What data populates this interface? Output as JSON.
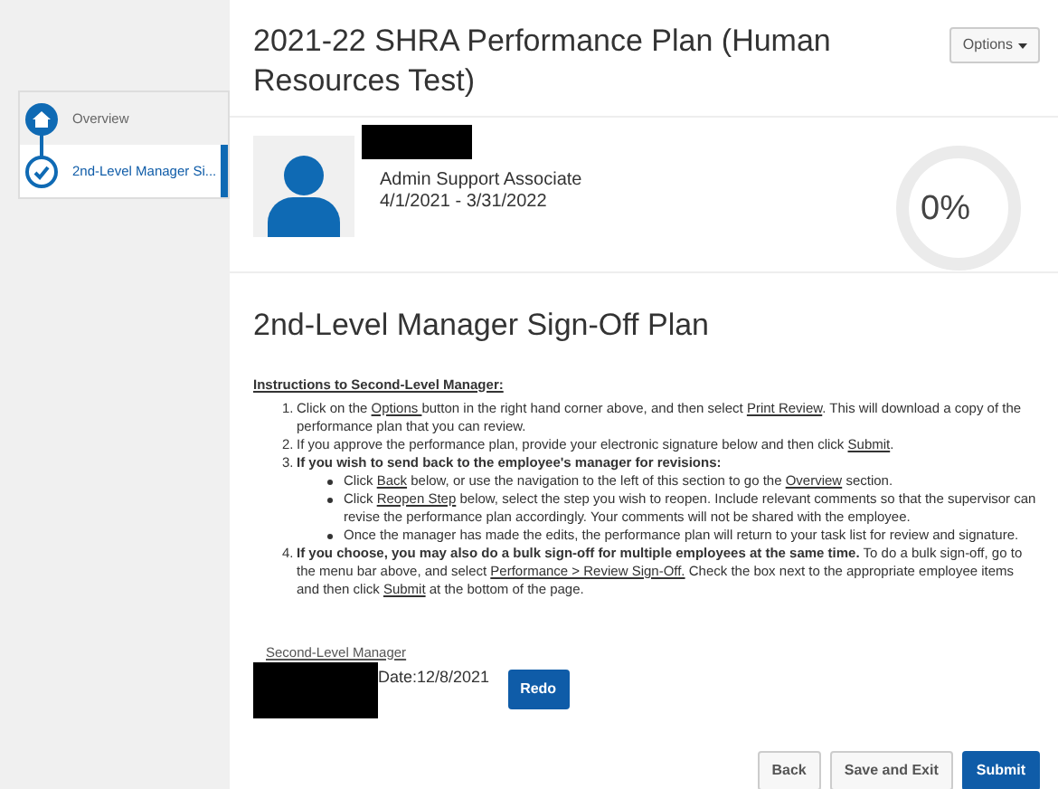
{
  "sidebar": {
    "items": [
      {
        "label": "Overview",
        "kind": "home",
        "selected": false
      },
      {
        "label": "2nd-Level Manager Si...",
        "kind": "check",
        "selected": true
      }
    ]
  },
  "header": {
    "title": "2021-22 SHRA Performance Plan (Human Resources Test)",
    "options_button": "Options"
  },
  "profile": {
    "job_title": "Admin Support Associate",
    "period": "4/1/2021 - 3/31/2022",
    "progress": {
      "level": 0,
      "reading": "0%"
    }
  },
  "section": {
    "title": "2nd-Level Manager Sign-Off Plan",
    "instructions_heading": "Instructions to Second-Level Manager:",
    "steps": [
      {
        "marker": "1.",
        "segments": [
          {
            "kind": "plain",
            "text": "Click on the "
          },
          {
            "kind": "link",
            "text": "Options "
          },
          {
            "kind": "plain",
            "text": "button in the right hand corner above, and then select "
          },
          {
            "kind": "link",
            "text": "Print Review"
          },
          {
            "kind": "plain",
            "text": ". This will download a copy of the performance plan that you can review."
          }
        ]
      },
      {
        "marker": "2.",
        "segments": [
          {
            "kind": "plain",
            "text": "If you approve the performance plan, provide your electronic signature below and then click "
          },
          {
            "kind": "link",
            "text": "Submit"
          },
          {
            "kind": "plain",
            "text": "."
          }
        ]
      },
      {
        "marker": "3.",
        "segments": [
          {
            "kind": "bold",
            "text": "If you wish to send back to the employee's manager for revisions:"
          }
        ],
        "bullets": [
          [
            {
              "kind": "plain",
              "text": "Click "
            },
            {
              "kind": "link",
              "text": "Back"
            },
            {
              "kind": "plain",
              "text": " below, or use the navigation to the left of this section to go the "
            },
            {
              "kind": "link",
              "text": "Overview"
            },
            {
              "kind": "plain",
              "text": " section."
            }
          ],
          [
            {
              "kind": "plain",
              "text": "Click "
            },
            {
              "kind": "link",
              "text": "Reopen Step"
            },
            {
              "kind": "plain",
              "text": " below, select the step you wish to reopen. Include relevant comments so that the supervisor can revise the performance plan accordingly. Your comments will not be shared with the employee."
            }
          ],
          [
            {
              "kind": "plain",
              "text": "Once the manager has made the edits, the performance plan will return to your task list for review and signature."
            }
          ]
        ]
      },
      {
        "marker": "4.",
        "segments": [
          {
            "kind": "bold",
            "text": "If you choose, you may also do a bulk sign-off for multiple employees at the same time."
          },
          {
            "kind": "plain",
            "text": " To do a bulk sign-off, go to the menu bar above, and select "
          },
          {
            "kind": "link",
            "text": "Performance > Review Sign-Off."
          },
          {
            "kind": "plain",
            "text": " Check the box next to the appropriate employee items and then click "
          },
          {
            "kind": "link",
            "text": "Submit"
          },
          {
            "kind": "plain",
            "text": " at the bottom of the page."
          }
        ]
      }
    ]
  },
  "signature": {
    "label": "Second-Level Manager",
    "date": "Date:12/8/2021",
    "redo_button": "Redo"
  },
  "footer_buttons": [
    {
      "label": "Back",
      "kind": "default"
    },
    {
      "label": "Save and Exit",
      "kind": "default"
    },
    {
      "label": "Submit",
      "kind": "primary"
    }
  ]
}
